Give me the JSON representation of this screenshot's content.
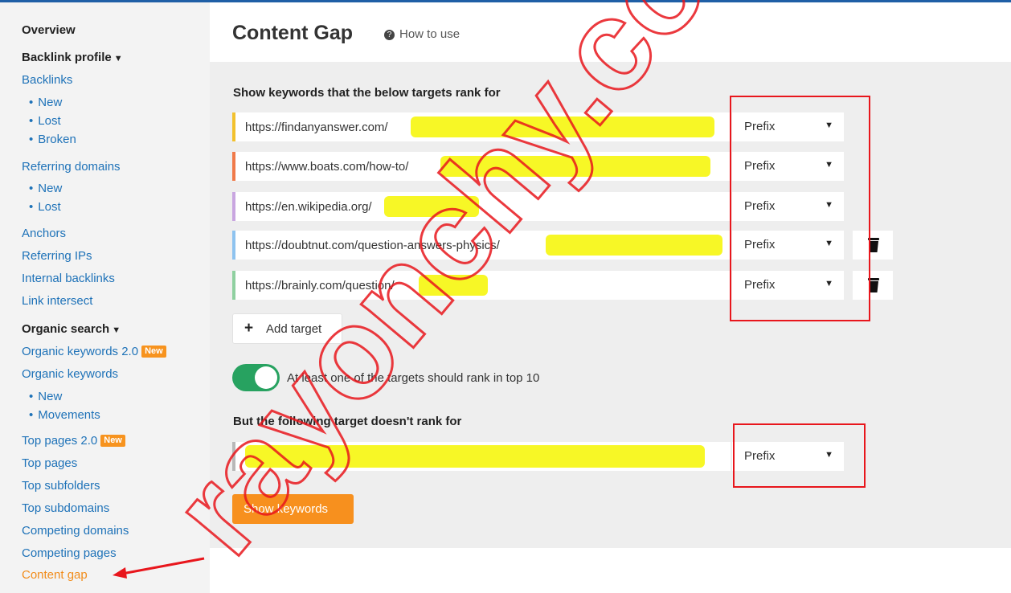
{
  "sidebar": {
    "overview": "Overview",
    "backlink_profile": "Backlink profile",
    "backlinks": "Backlinks",
    "backlinks_new": "New",
    "backlinks_lost": "Lost",
    "backlinks_broken": "Broken",
    "referring_domains": "Referring domains",
    "rd_new": "New",
    "rd_lost": "Lost",
    "anchors": "Anchors",
    "referring_ips": "Referring IPs",
    "internal_backlinks": "Internal backlinks",
    "link_intersect": "Link intersect",
    "organic_search": "Organic search",
    "organic_keywords_2": "Organic keywords 2.0",
    "organic_keywords": "Organic keywords",
    "ok_new": "New",
    "ok_movements": "Movements",
    "top_pages_2": "Top pages 2.0",
    "top_pages": "Top pages",
    "top_subfolders": "Top subfolders",
    "top_subdomains": "Top subdomains",
    "competing_domains": "Competing domains",
    "competing_pages": "Competing pages",
    "content_gap": "Content gap",
    "new_badge": "New"
  },
  "header": {
    "title": "Content Gap",
    "how_to_use": "How to use"
  },
  "targets_section": {
    "title": "Show keywords that the below targets rank for",
    "targets": [
      {
        "url": "https://findanyanswer.com/",
        "mode": "Prefix",
        "accent": "#f2c12e"
      },
      {
        "url": "https://www.boats.com/how-to/",
        "mode": "Prefix",
        "accent": "#f07a4a"
      },
      {
        "url": "https://en.wikipedia.org/",
        "mode": "Prefix",
        "accent": "#c9a6e0"
      },
      {
        "url": "https://doubtnut.com/question-answers-physics/",
        "mode": "Prefix",
        "accent": "#8ec3ef"
      },
      {
        "url": "https://brainly.com/question/",
        "mode": "Prefix",
        "accent": "#8fd0a0"
      }
    ],
    "add_target": "Add target"
  },
  "toggle": {
    "label": "At least one of the targets should rank in top 10",
    "on": true
  },
  "exclude_section": {
    "title": "But the following target doesn't rank for",
    "mode": "Prefix"
  },
  "show_keywords": "Show keywords",
  "watermark": "rayonchy.com",
  "colors": {
    "link": "#1e72b8",
    "active": "#f28c1a",
    "button": "#f7901e",
    "toggle": "#27a260",
    "annotation": "#e8161c",
    "highlight": "#f7f71a"
  }
}
